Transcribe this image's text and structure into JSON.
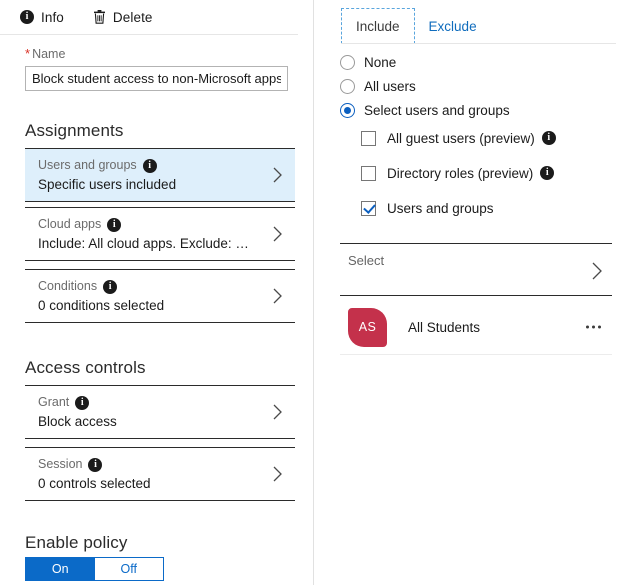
{
  "left": {
    "command_bar": {
      "info_label": "Info",
      "info_icon": "info-circle-icon",
      "delete_label": "Delete",
      "delete_icon": "trash-icon"
    },
    "name_field": {
      "required_marker": "*",
      "label": "Name",
      "value": "Block student access to non-Microsoft apps"
    },
    "assignments": {
      "heading": "Assignments",
      "rows": [
        {
          "title": "Users and groups",
          "subtitle": "Specific users included",
          "selected": true
        },
        {
          "title": "Cloud apps",
          "subtitle": "Include: All cloud apps. Exclude: …",
          "selected": false
        },
        {
          "title": "Conditions",
          "subtitle": "0 conditions selected",
          "selected": false
        }
      ]
    },
    "access_controls": {
      "heading": "Access controls",
      "rows": [
        {
          "title": "Grant",
          "subtitle": "Block access",
          "selected": false
        },
        {
          "title": "Session",
          "subtitle": "0 controls selected",
          "selected": false
        }
      ]
    },
    "enable_policy": {
      "heading": "Enable policy",
      "on_label": "On",
      "off_label": "Off",
      "selected": "On"
    }
  },
  "right": {
    "tabs": [
      {
        "label": "Include",
        "active": true
      },
      {
        "label": "Exclude",
        "active": false
      }
    ],
    "radios": [
      {
        "label": "None",
        "checked": false
      },
      {
        "label": "All users",
        "checked": false
      },
      {
        "label": "Select users and groups",
        "checked": true
      }
    ],
    "checkboxes": [
      {
        "label": "All guest users (preview)",
        "checked": false,
        "info": true
      },
      {
        "label": "Directory roles (preview)",
        "checked": false,
        "info": true
      },
      {
        "label": "Users and groups",
        "checked": true,
        "info": false
      }
    ],
    "select_row": {
      "label": "Select"
    },
    "members": [
      {
        "initials": "AS",
        "name": "All Students",
        "avatar_color": "#c4314b"
      }
    ]
  },
  "colors": {
    "accent_blue": "#0b6ac8",
    "link_blue": "#0f6cbd",
    "selected_row_bg": "#deeffb",
    "avatar_crimson": "#c4314b",
    "required_red": "#d93025"
  }
}
